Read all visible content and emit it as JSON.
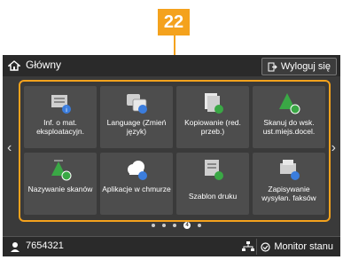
{
  "callout": {
    "number": "22"
  },
  "header": {
    "title": "Główny",
    "logout_label": "Wyloguj się"
  },
  "tiles": [
    {
      "label": "Inf. o mat. eksploatacyjn.",
      "icon": "printer-info-icon"
    },
    {
      "label": "Language (Zmień język)",
      "icon": "language-icon"
    },
    {
      "label": "Kopiowanie (red. przeb.)",
      "icon": "copy-icon"
    },
    {
      "label": "Skanuj do wsk. ust.miejs.docel.",
      "icon": "scan-tree-icon"
    },
    {
      "label": "Nazywanie skanów",
      "icon": "scan-name-icon"
    },
    {
      "label": "Aplikacje w chmurze",
      "icon": "cloud-icon"
    },
    {
      "label": "Szablon druku",
      "icon": "template-icon"
    },
    {
      "label": "Zapisywanie wysyłan. faksów",
      "icon": "fax-save-icon"
    }
  ],
  "pagination": {
    "active_page": "4"
  },
  "footer": {
    "user_id": "7654321",
    "monitor_label": "Monitor stanu"
  },
  "colors": {
    "accent": "#f4a21d",
    "screen_bg": "#3a3a3a",
    "tile_bg": "#4d4d4d"
  }
}
